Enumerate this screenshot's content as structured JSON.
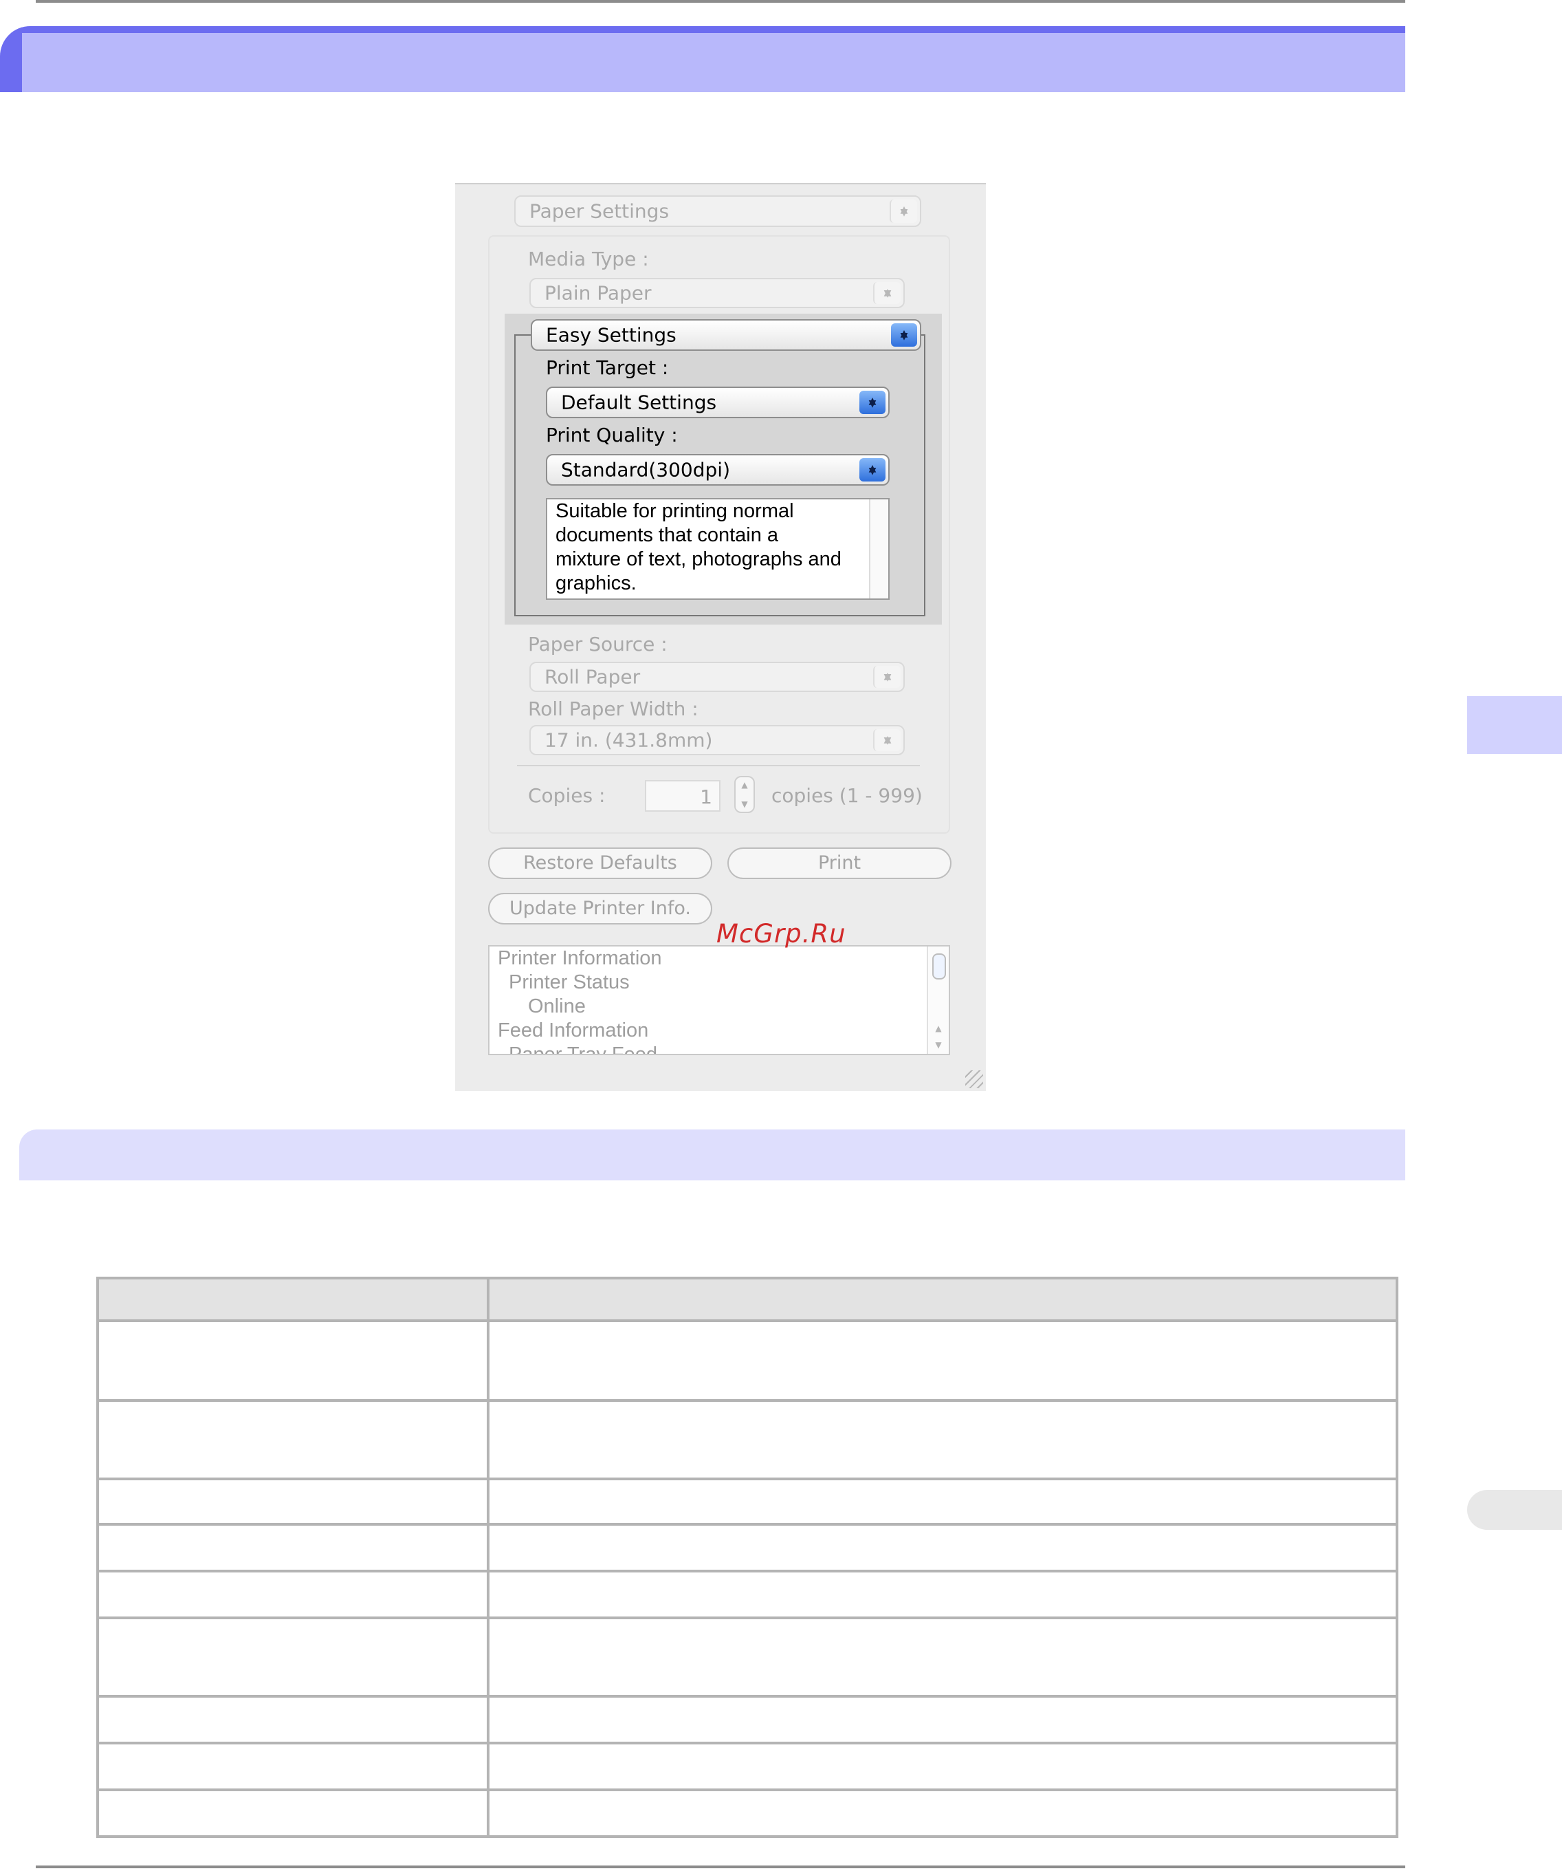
{
  "dialog": {
    "panel_popup": "Paper Settings",
    "media_type_label": "Media Type :",
    "media_type_value": "Plain Paper",
    "mode_popup": "Easy Settings",
    "print_target_label": "Print Target :",
    "print_target_value": "Default Settings",
    "print_quality_label": "Print Quality :",
    "print_quality_value": "Standard(300dpi)",
    "description_lines": [
      "Suitable for printing normal",
      "documents that contain a",
      "mixture of text, photographs and",
      "graphics."
    ],
    "paper_source_label": "Paper Source :",
    "paper_source_value": "Roll Paper",
    "roll_width_label": "Roll Paper Width :",
    "roll_width_value": "17 in. (431.8mm)",
    "copies_label": "Copies :",
    "copies_value": "1",
    "copies_range": "copies (1 - 999)",
    "restore_defaults": "Restore Defaults",
    "print_button": "Print",
    "update_printer_info": "Update Printer Info.",
    "info_lines": [
      "Printer Information",
      "Printer Status",
      "Online",
      "Feed Information",
      "Paper Tray Feed"
    ]
  },
  "watermark": "McGrp.Ru",
  "table_rows": 9
}
